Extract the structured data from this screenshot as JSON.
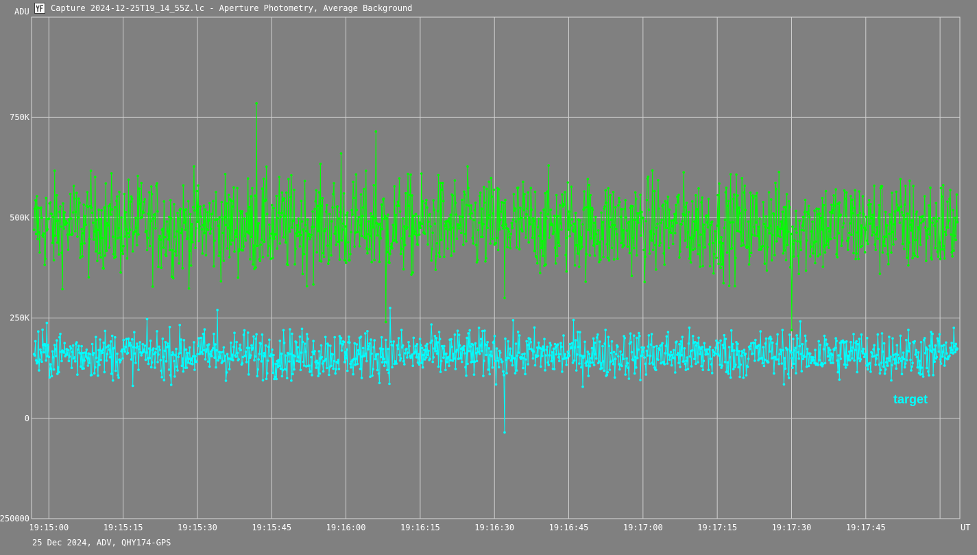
{
  "window": {
    "title": "Capture 2024-12-25T19_14_55Z.lc - Aperture Photometry, Average Background",
    "icon": "photometry-app-icon"
  },
  "footer": {
    "info": "25 Dec 2024, ADV, QHY174-GPS"
  },
  "chart_data": {
    "type": "line",
    "ylabel": "ADU",
    "xlabel": "UT",
    "ylim": [
      -250000,
      1000000
    ],
    "xlim": [
      "19:14:56.5",
      "19:18:04"
    ],
    "y_ticks": [
      {
        "value": 750000,
        "label": "750K"
      },
      {
        "value": 500000,
        "label": "500K"
      },
      {
        "value": 250000,
        "label": "250K"
      },
      {
        "value": 0,
        "label": "0"
      },
      {
        "value": -250000,
        "label": "250000"
      }
    ],
    "x_ticks": [
      "19:15:00",
      "19:15:15",
      "19:15:30",
      "19:15:45",
      "19:16:00",
      "19:16:15",
      "19:16:30",
      "19:16:45",
      "19:17:00",
      "19:17:15",
      "19:17:30",
      "19:17:45"
    ],
    "grid": true,
    "series": [
      {
        "name": "",
        "color": "#00ff00",
        "approx_mean": 480000,
        "approx_spread": 60000,
        "samples": [
          {
            "x": "19:14:57.0",
            "y": 470000
          },
          {
            "x": "19:15:10.0",
            "y": 520000
          },
          {
            "x": "19:15:20.0",
            "y": 450000
          },
          {
            "x": "19:15:30.0",
            "y": 490000
          },
          {
            "x": "19:15:42.0",
            "y": 785000
          },
          {
            "x": "19:15:45.0",
            "y": 460000
          },
          {
            "x": "19:15:59.0",
            "y": 660000
          },
          {
            "x": "19:16:06.0",
            "y": 715000
          },
          {
            "x": "19:16:08.0",
            "y": 240000
          },
          {
            "x": "19:16:20.0",
            "y": 480000
          },
          {
            "x": "19:16:32.0",
            "y": 300000
          },
          {
            "x": "19:16:45.0",
            "y": 470000
          },
          {
            "x": "19:17:00.0",
            "y": 500000
          },
          {
            "x": "19:17:15.0",
            "y": 480000
          },
          {
            "x": "19:17:30.0",
            "y": 220000
          },
          {
            "x": "19:17:45.0",
            "y": 470000
          },
          {
            "x": "19:18:03.0",
            "y": 500000
          }
        ]
      },
      {
        "name": "target",
        "color": "#00ffff",
        "approx_mean": 160000,
        "approx_spread": 30000,
        "samples": [
          {
            "x": "19:14:57.0",
            "y": 160000
          },
          {
            "x": "19:15:10.0",
            "y": 170000
          },
          {
            "x": "19:15:20.0",
            "y": 150000
          },
          {
            "x": "19:15:34.0",
            "y": 270000
          },
          {
            "x": "19:15:45.0",
            "y": 160000
          },
          {
            "x": "19:16:00.0",
            "y": 150000
          },
          {
            "x": "19:16:09.0",
            "y": 275000
          },
          {
            "x": "19:16:20.0",
            "y": 160000
          },
          {
            "x": "19:16:32.0",
            "y": -35000
          },
          {
            "x": "19:16:45.0",
            "y": 155000
          },
          {
            "x": "19:17:00.0",
            "y": 165000
          },
          {
            "x": "19:17:15.0",
            "y": 160000
          },
          {
            "x": "19:17:30.0",
            "y": 150000
          },
          {
            "x": "19:17:45.0",
            "y": 160000
          },
          {
            "x": "19:18:03.0",
            "y": 165000
          }
        ]
      }
    ]
  }
}
